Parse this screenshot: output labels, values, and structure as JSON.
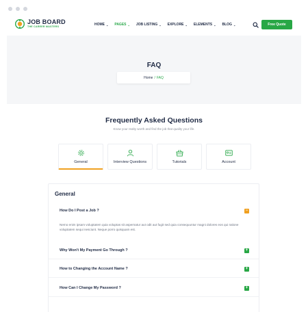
{
  "site": {
    "logo_title": "JOB BOARD",
    "logo_subtitle": "THE CAREER MASTERS"
  },
  "nav": {
    "items": [
      {
        "label": "HOME",
        "active": false
      },
      {
        "label": "PAGES",
        "active": true
      },
      {
        "label": "JOB LISTING",
        "active": false
      },
      {
        "label": "EXPLORE",
        "active": false
      },
      {
        "label": "ELEMENTS",
        "active": false
      },
      {
        "label": "BLOG",
        "active": false
      }
    ],
    "quote_button": "Free Quote"
  },
  "hero": {
    "title": "FAQ",
    "breadcrumb_home": "Home",
    "breadcrumb_sep": "/",
    "breadcrumb_current": "FAQ"
  },
  "section": {
    "title": "Frequently Asked Questions",
    "subtitle": "Know your realty worth and find the job that quality your life."
  },
  "tabs": [
    {
      "label": "General",
      "icon": "gear-icon",
      "active": true
    },
    {
      "label": "Interview Questions",
      "icon": "user-icon",
      "active": false
    },
    {
      "label": "Tutorials",
      "icon": "basket-icon",
      "active": false
    },
    {
      "label": "Account",
      "icon": "id-card-icon",
      "active": false
    }
  ],
  "faq": {
    "heading": "General",
    "answer": "Nemo enim ipsam voluptatem quia voluptas sit aspernatur aut odit aut fugit sed quia consequuntur magni dolores eos qui ratione voluptatem sequi nesciunt. Neque porro quisquam est.",
    "questions": [
      {
        "q": "How Do I Post a Job ?",
        "toggle": "−",
        "open": true
      },
      {
        "q": "Why Won't My Payment Go Through ?",
        "toggle": "+",
        "open": false
      },
      {
        "q": "How to Changing the Account Name ?",
        "toggle": "+",
        "open": false
      },
      {
        "q": "How Can I Change My Password ?",
        "toggle": "+",
        "open": false
      }
    ]
  },
  "colors": {
    "accent_green": "#28a745",
    "accent_orange": "#f0a020",
    "navy": "#1f2a44"
  }
}
